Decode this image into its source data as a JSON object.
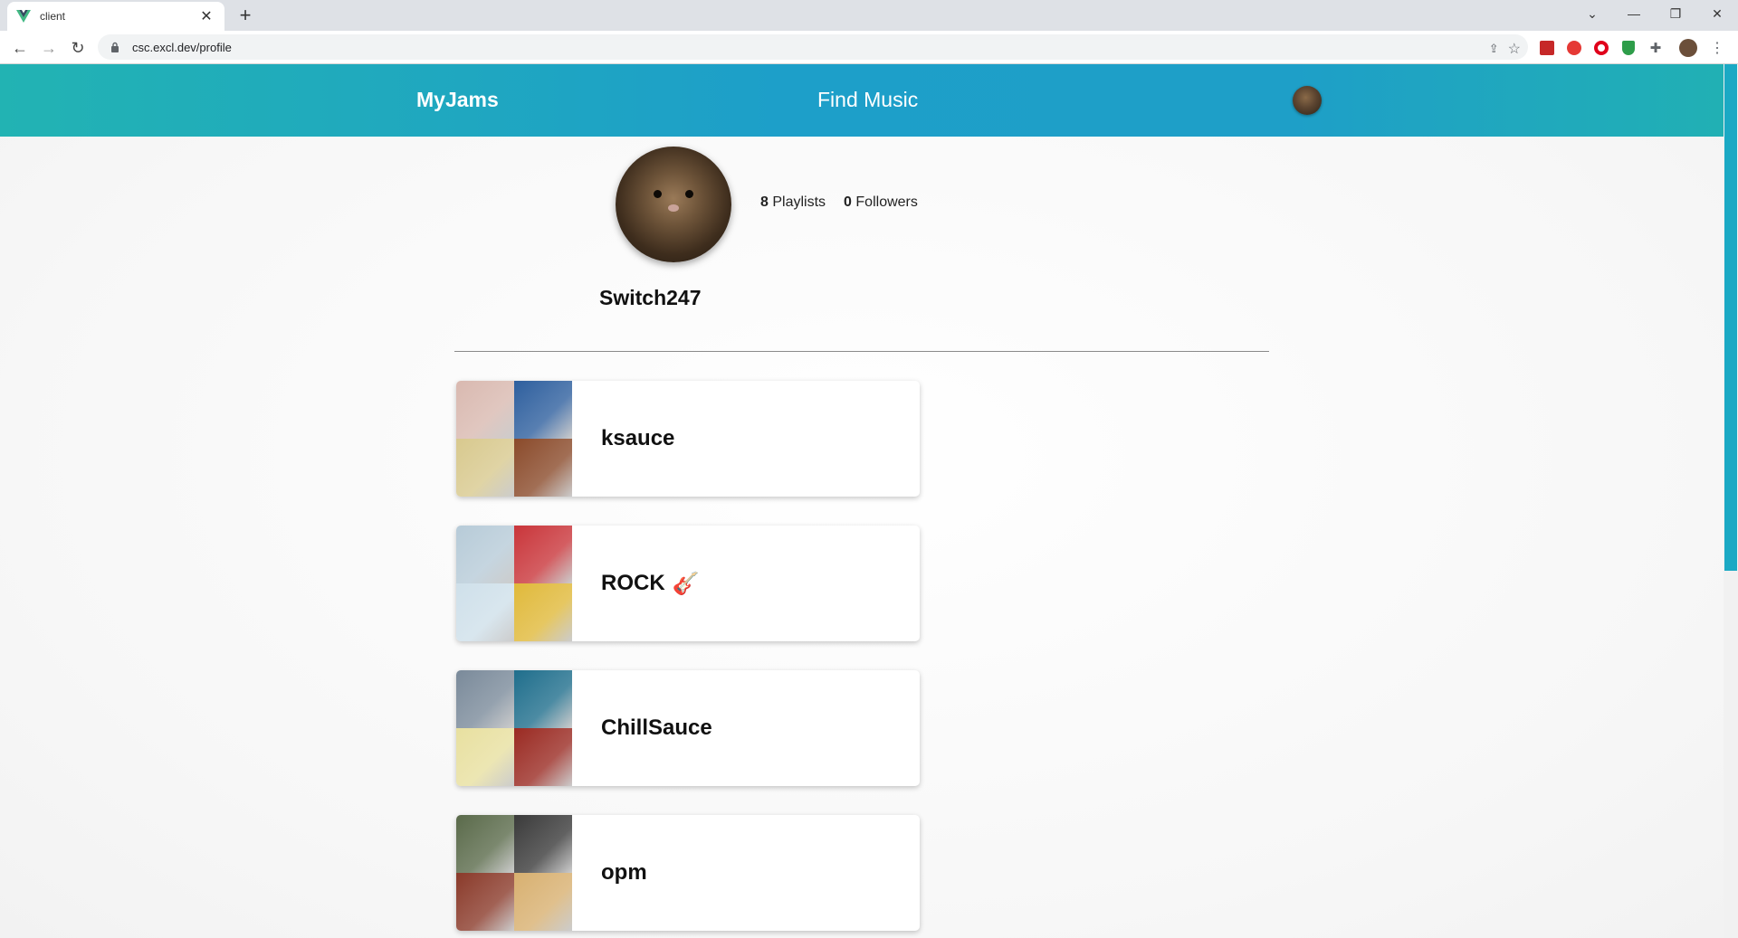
{
  "browser": {
    "tab_title": "client",
    "url": "csc.excl.dev/profile"
  },
  "app": {
    "brand": "MyJams",
    "nav_find_music": "Find Music"
  },
  "profile": {
    "username": "Switch247",
    "playlists_count": "8",
    "playlists_label": "Playlists",
    "followers_count": "0",
    "followers_label": "Followers"
  },
  "playlists": [
    {
      "name": "ksauce",
      "emoji": "",
      "covers": [
        "#d9b9b0",
        "#2e5f9e",
        "#d8c98e",
        "#8a4a2a"
      ]
    },
    {
      "name": "ROCK",
      "emoji": "🎸",
      "covers": [
        "#b7cbd8",
        "#c9353a",
        "#cfe0ea",
        "#e0b93a"
      ]
    },
    {
      "name": "ChillSauce",
      "emoji": "",
      "covers": [
        "#7a8a9a",
        "#1f6e8c",
        "#e8e0a0",
        "#9a2a22"
      ]
    },
    {
      "name": "opm",
      "emoji": "",
      "covers": [
        "#5a6a4a",
        "#3a3a3a",
        "#8a3a2a",
        "#d8b070"
      ]
    }
  ],
  "colors": {
    "appbar_start": "#22b3b3",
    "appbar_mid": "#1d9fc9",
    "scroll_thumb": "#1ba9c4"
  }
}
